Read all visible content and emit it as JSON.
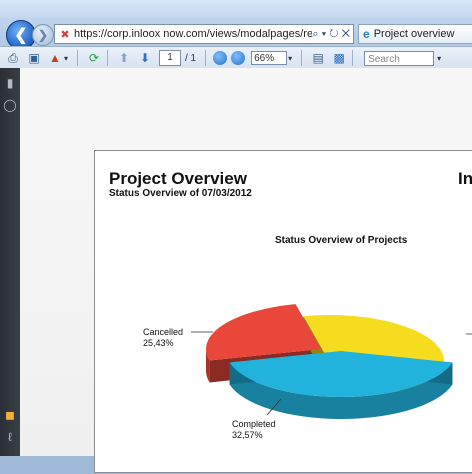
{
  "browser": {
    "url": "https://corp.inloox now.com/views/modalpages/reportdisplayfile",
    "tab_title": "Project overview",
    "addr_tools": "⌕ ▾ ↻ ✕"
  },
  "toolbar": {
    "page_current": "1",
    "page_total": "/ 1",
    "zoom": "66%",
    "search_placeholder": "Search"
  },
  "icons": {
    "back": "back-arrow-icon",
    "forward": "forward-arrow-icon",
    "print": "printer-icon",
    "save": "save-icon",
    "export": "export-icon",
    "refresh": "refresh-icon",
    "prev": "up-arrow-icon",
    "next": "down-arrow-icon",
    "pages": "pages-icon",
    "find": "binoculars-icon",
    "comments": "comment-icon",
    "attachments": "paperclip-icon"
  },
  "report": {
    "title": "Project Overview",
    "subtitle": "Status Overview of 07/03/2012",
    "right_title_fragment": "In"
  },
  "chart_data": {
    "type": "pie",
    "title": "Status Overview of Projects",
    "slices": [
      {
        "name": "Cancelled",
        "label": "25,43%",
        "value": 25.43,
        "color": "#e8473a"
      },
      {
        "name": "Completed",
        "label": "32,57%",
        "value": 32.57,
        "color": "#f5dc1e"
      },
      {
        "name": "",
        "label": "",
        "value": 42.0,
        "color": "#22b3dd"
      }
    ]
  }
}
